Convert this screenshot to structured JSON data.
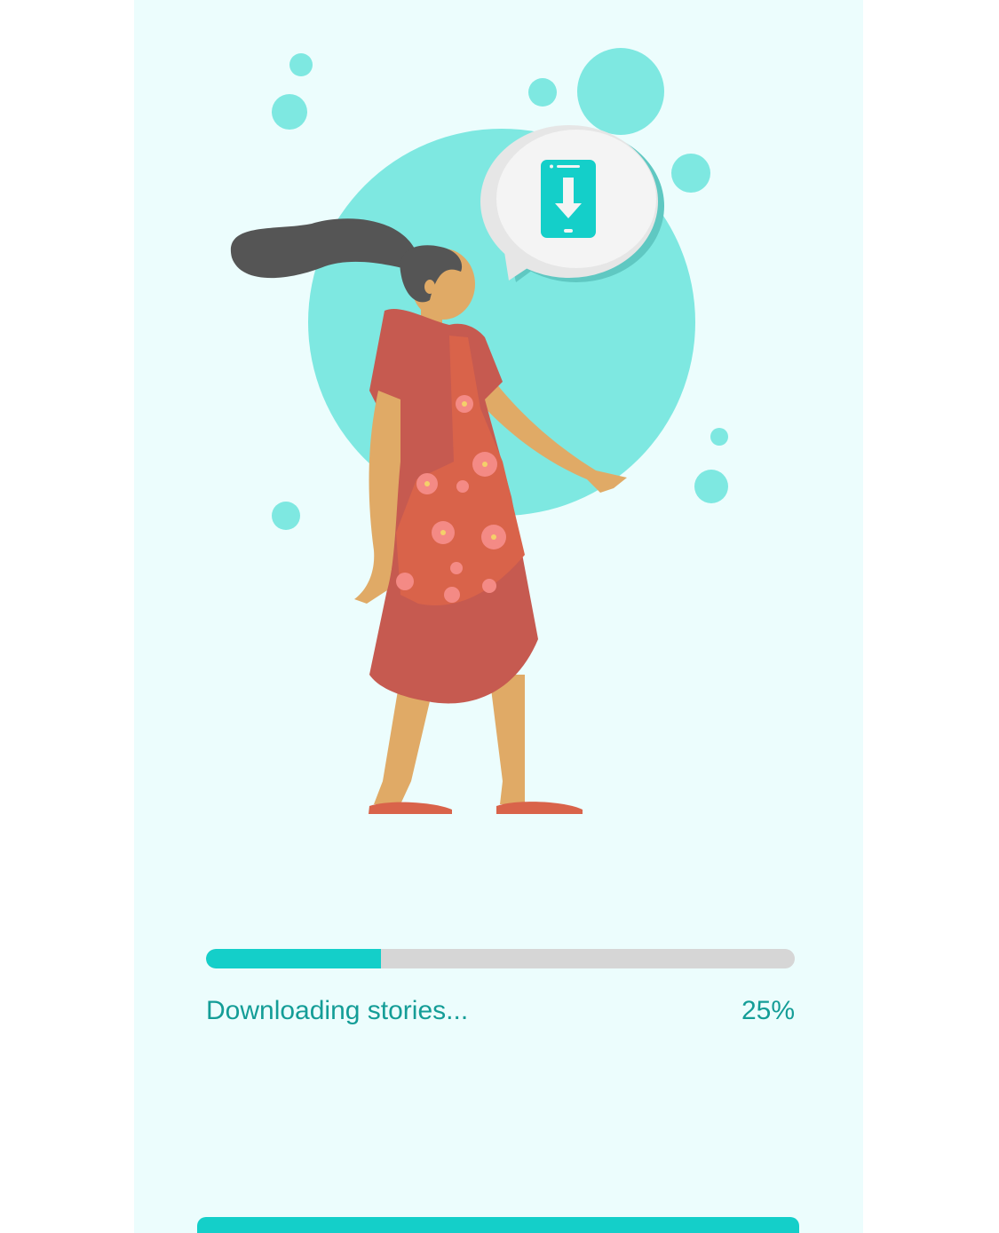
{
  "download": {
    "status_label": "Downloading stories...",
    "percent_label": "25%",
    "progress_fraction": 0.297
  },
  "colors": {
    "background": "#ecfdfd",
    "accent": "#14cfc9",
    "accent_text": "#149d97",
    "track": "#d6d6d6",
    "bubble": "#7ee8e1"
  },
  "illustration": {
    "icon": "phone-download-icon"
  }
}
